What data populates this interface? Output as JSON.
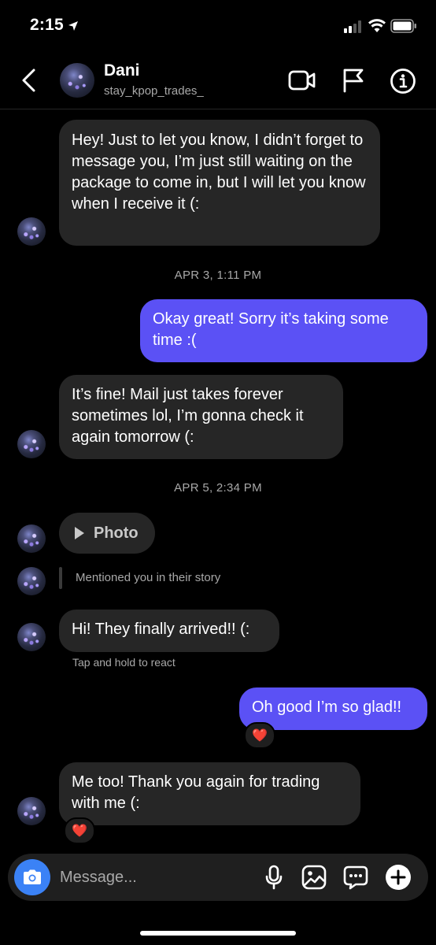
{
  "status": {
    "time": "2:15"
  },
  "header": {
    "name": "Dani",
    "username": "stay_kpop_trades_"
  },
  "messages": {
    "m1": "Hey! Just to let you know, I didn’t forget to message you, I’m just still waiting on the package to come in, but I will let you know when I receive it (:",
    "stamp1": "APR 3, 1:11 PM",
    "m2": "Okay great! Sorry it’s taking some time :(",
    "m3": "It’s fine! Mail just takes forever sometimes lol, I’m gonna check it again tomorrow (:",
    "stamp2": "APR 5, 2:34 PM",
    "photo_label": "Photo",
    "story_mention": "Mentioned you in their story",
    "m4": "Hi! They finally arrived!! (:",
    "react_hint": "Tap and hold to react",
    "m5": "Oh good I’m so glad!!",
    "m6": "Me too! Thank you again for trading with me (:"
  },
  "reactions": {
    "r1": "❤️",
    "r2": "❤️"
  },
  "composer": {
    "placeholder": "Message..."
  },
  "colors": {
    "outgoing": "#5b51f5",
    "incoming": "#262626",
    "camera": "#3b82f6"
  }
}
